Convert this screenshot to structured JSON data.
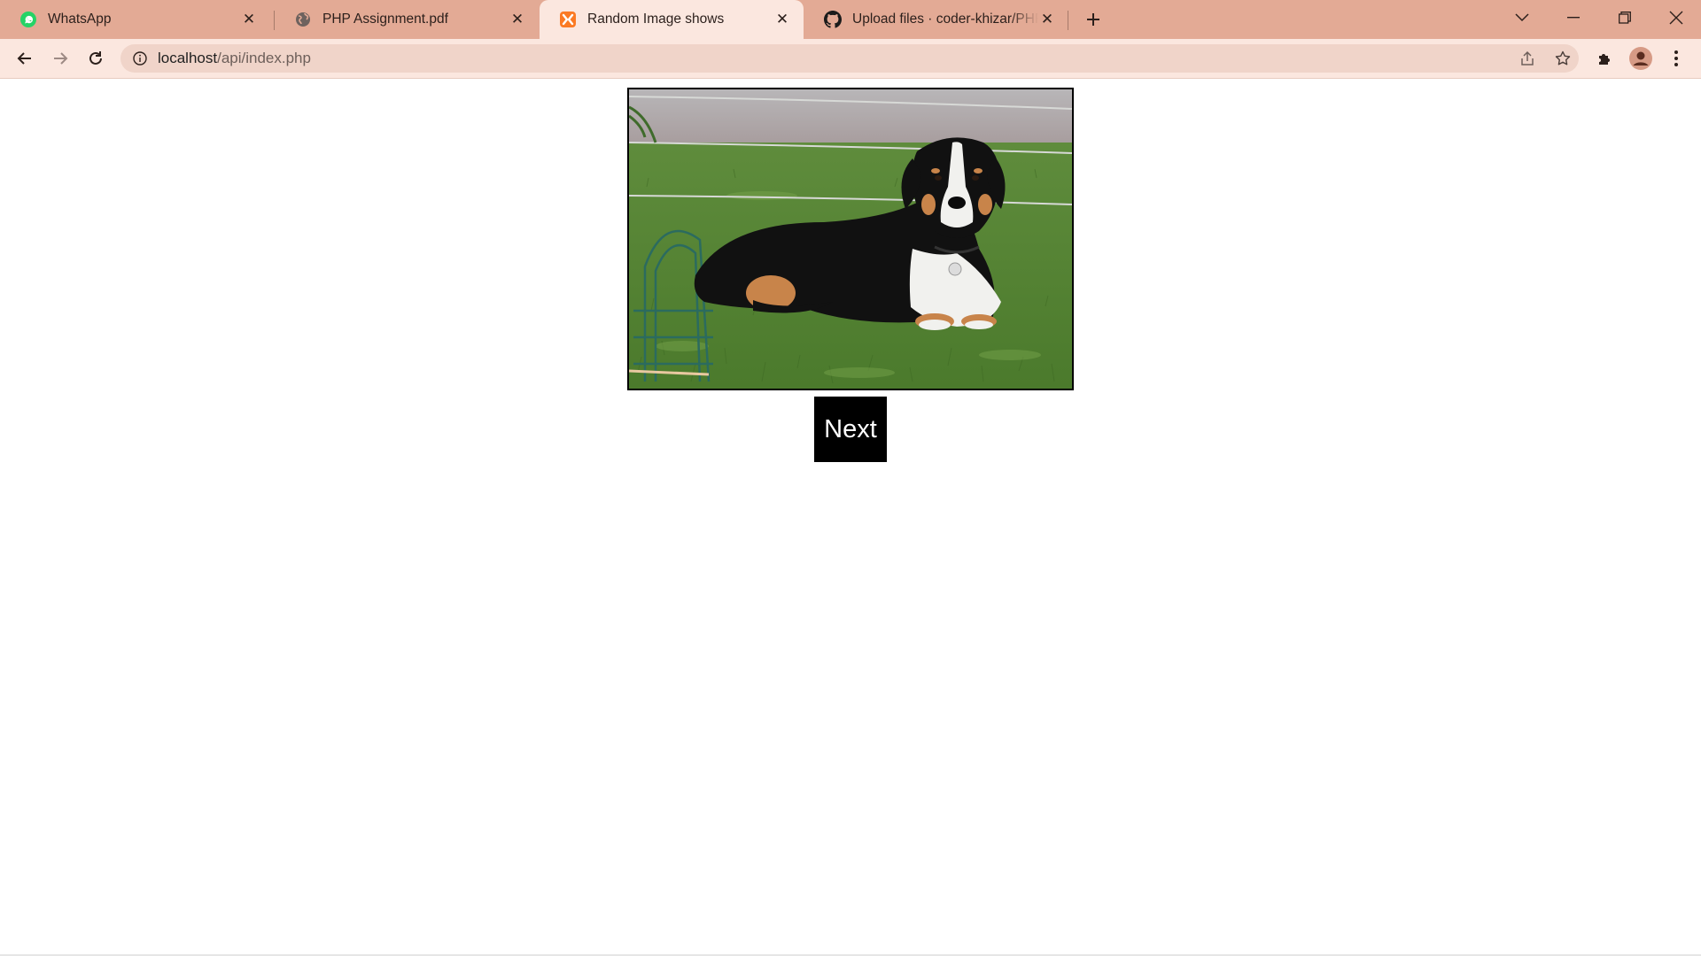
{
  "tabs": [
    {
      "title": "WhatsApp",
      "icon": "whatsapp-icon",
      "active": false
    },
    {
      "title": "PHP Assignment.pdf",
      "icon": "globe-icon",
      "active": false
    },
    {
      "title": "Random Image shows",
      "icon": "xampp-icon",
      "active": true
    },
    {
      "title": "Upload files · coder-khizar/PHP-P",
      "icon": "github-icon",
      "active": false
    }
  ],
  "toolbar": {
    "url_host": "localhost",
    "url_path": "/api/index.php"
  },
  "page": {
    "image_subject": "Greater Swiss Mountain Dog lying on grass",
    "next_label": "Next"
  },
  "colors": {
    "tabstrip": "#e3aa95",
    "active_tab": "#fbe7df",
    "omnibox": "#f0d4c9",
    "button_bg": "#000000",
    "button_text": "#ffffff"
  }
}
